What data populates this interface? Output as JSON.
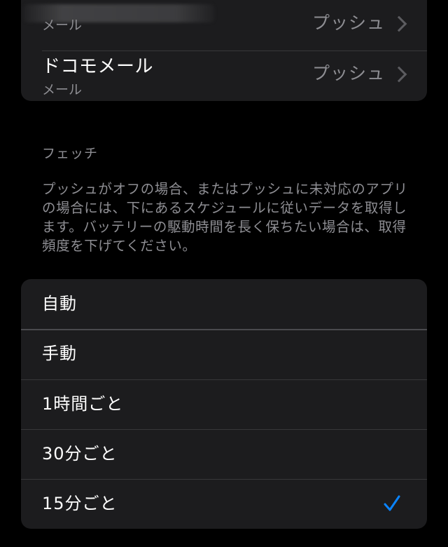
{
  "accounts": [
    {
      "name": "",
      "subtitle": "メール",
      "value": "プッシュ"
    },
    {
      "name": "ドコモメール",
      "subtitle": "メール",
      "value": "プッシュ"
    }
  ],
  "fetch": {
    "header": "フェッチ",
    "description": "プッシュがオフの場合、またはプッシュに未対応のアプリの場合には、下にあるスケジュールに従いデータを取得します。バッテリーの駆動時間を長く保ちたい場合は、取得頻度を下げてください。",
    "options": [
      {
        "label": "自動",
        "selected": false
      },
      {
        "label": "手動",
        "selected": false
      },
      {
        "label": "1時間ごと",
        "selected": false
      },
      {
        "label": "30分ごと",
        "selected": false
      },
      {
        "label": "15分ごと",
        "selected": true
      }
    ]
  },
  "colors": {
    "background": "#000000",
    "group_background": "#1c1c1e",
    "secondary_text": "#8e8e93",
    "accent": "#0a84ff"
  },
  "icons": {
    "disclosure": "chevron-right-icon",
    "selected": "checkmark-icon"
  }
}
